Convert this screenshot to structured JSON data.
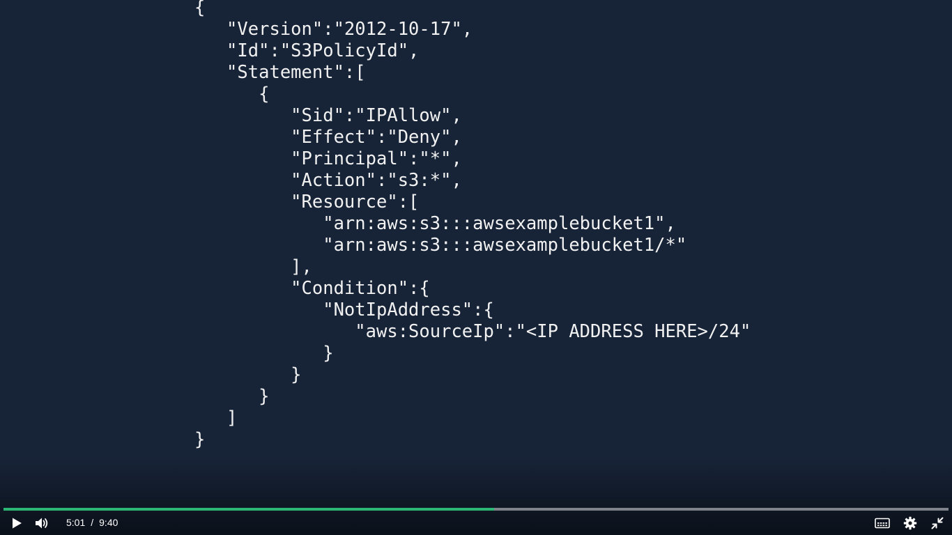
{
  "code": {
    "lines": [
      "{",
      "   \"Version\":\"2012-10-17\",",
      "   \"Id\":\"S3PolicyId\",",
      "   \"Statement\":[",
      "      {",
      "         \"Sid\":\"IPAllow\",",
      "         \"Effect\":\"Deny\",",
      "         \"Principal\":\"*\",",
      "         \"Action\":\"s3:*\",",
      "         \"Resource\":[",
      "            \"arn:aws:s3:::awsexamplebucket1\",",
      "            \"arn:aws:s3:::awsexamplebucket1/*\"",
      "         ],",
      "         \"Condition\":{",
      "            \"NotIpAddress\":{",
      "               \"aws:SourceIp\":\"<IP ADDRESS HERE>/24\"",
      "            }",
      "         }",
      "      }",
      "   ]",
      "}"
    ]
  },
  "player": {
    "current_time": "5:01",
    "separator": "/",
    "duration": "9:40",
    "progress_fraction": 0.519,
    "played_color": "#2bb673",
    "icons": [
      "play-icon",
      "volume-icon",
      "captions-icon",
      "settings-icon",
      "exit-fullscreen-icon"
    ]
  }
}
